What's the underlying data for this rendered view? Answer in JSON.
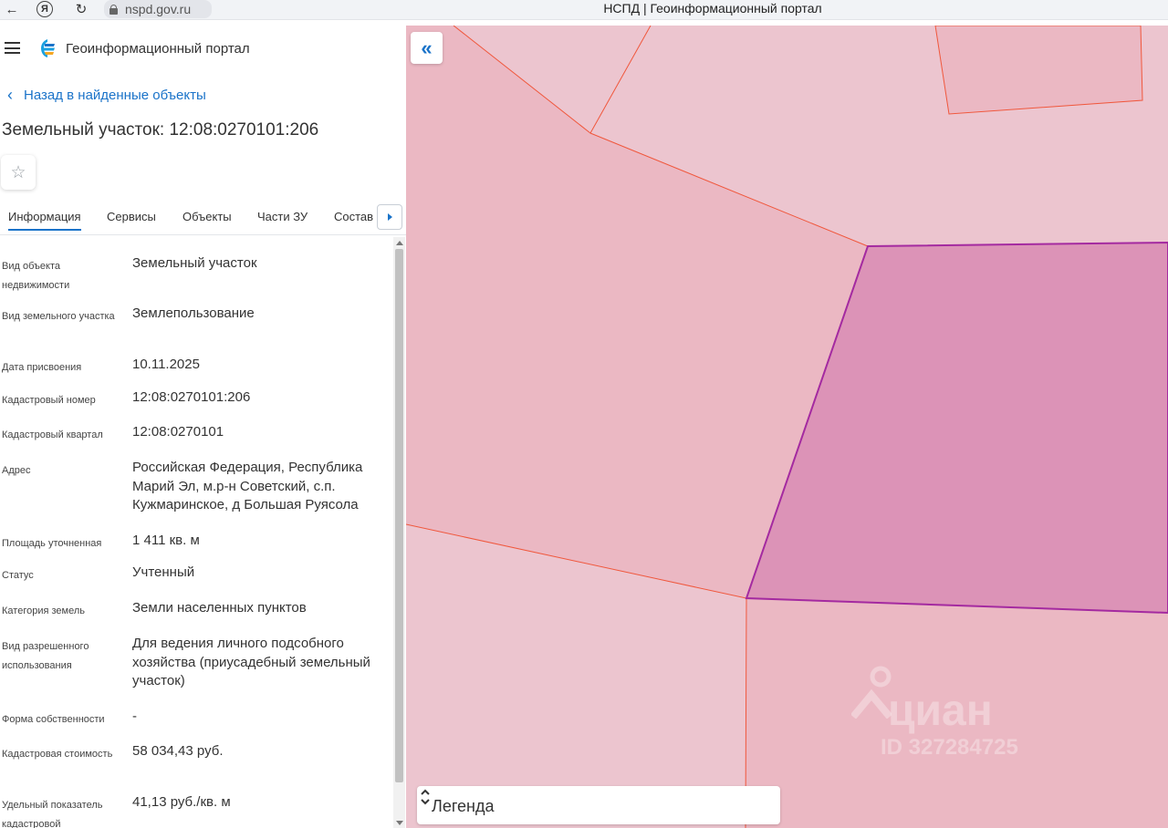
{
  "browser": {
    "url": "nspd.gov.ru",
    "tab_title": "НСПД | Геоинформационный портал",
    "back_icon": "←",
    "yandex_icon": "Я",
    "reload_icon": "↻"
  },
  "header": {
    "app_title": "Геоинформационный портал"
  },
  "back_link": {
    "label": "Назад в найденные объекты"
  },
  "object": {
    "title": "Земельный участок: 12:08:0270101:206"
  },
  "tabs": [
    {
      "label": "Информация",
      "active": true
    },
    {
      "label": "Сервисы"
    },
    {
      "label": "Объекты"
    },
    {
      "label": "Части ЗУ"
    },
    {
      "label": "Состав"
    }
  ],
  "info_rows": [
    {
      "label": "Вид объекта недвижимости",
      "value": "Земельный участок"
    },
    {
      "label": "Вид земельного участка",
      "value": "Землепользование"
    },
    {
      "label": "Дата присвоения",
      "value": "10.11.2025"
    },
    {
      "label": "Кадастровый номер",
      "value": "12:08:0270101:206"
    },
    {
      "label": "Кадастровый квартал",
      "value": "12:08:0270101"
    },
    {
      "label": "Адрес",
      "value": "Российская Федерация, Республика Марий Эл, м.р-н Советский, с.п. Кужмаринское, д Большая Руясола"
    },
    {
      "label": "Площадь уточненная",
      "value": "1 411 кв. м"
    },
    {
      "label": "Статус",
      "value": "Учтенный"
    },
    {
      "label": "Категория земель",
      "value": "Земли населенных пунктов"
    },
    {
      "label": "Вид разрешенного использования",
      "value": "Для ведения личного подсобного хозяйства (приусадебный земельный участок)"
    },
    {
      "label": "Форма собственности",
      "value": "-"
    },
    {
      "label": "Кадастровая стоимость",
      "value": "58 034,43 руб."
    },
    {
      "label": "Удельный показатель кадастровой",
      "value": "41,13 руб./кв. м"
    }
  ],
  "map": {
    "collapse_icon": "«",
    "legend_label": "Легенда",
    "watermark_name": "циан",
    "watermark_id": "ID 327284725",
    "colors": {
      "parcel_fill": "#ebb8c3",
      "parcel_stroke": "#f0573c",
      "selected_fill": "#dc93b7",
      "selected_stroke": "#a42aa0",
      "background": "#ecc5cf"
    }
  },
  "colors": {
    "accent": "#1a73c9"
  }
}
